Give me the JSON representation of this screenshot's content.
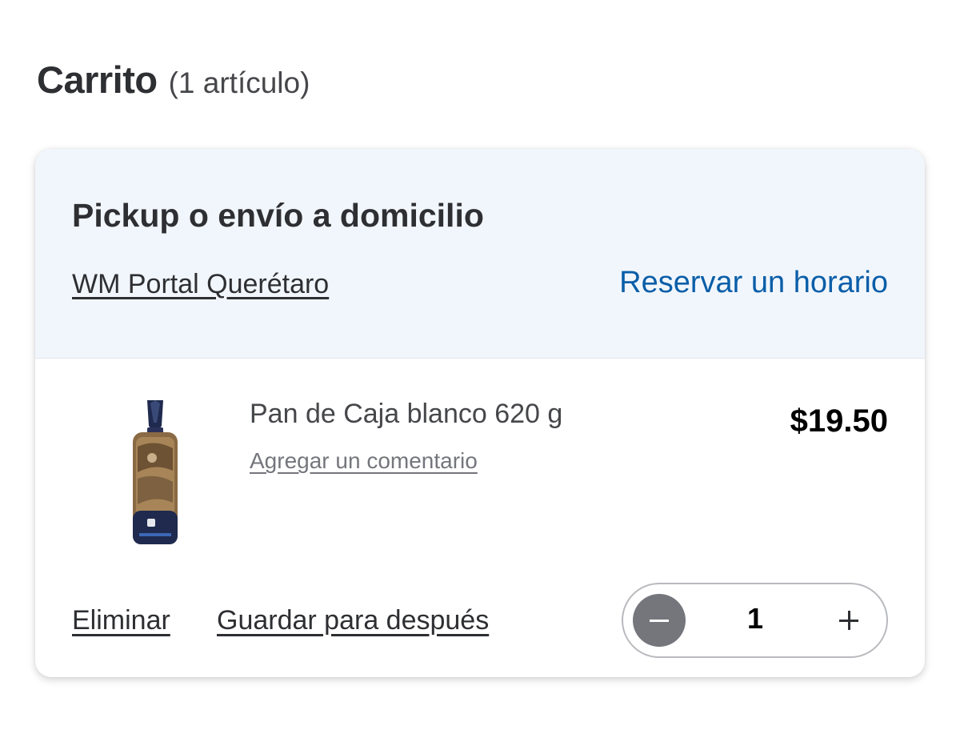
{
  "cart": {
    "title": "Carrito",
    "item_count": "(1 artículo)"
  },
  "fulfillment": {
    "title": "Pickup o envío a domicilio",
    "store": "WM Portal Querétaro",
    "reserve_label": "Reservar un horario"
  },
  "items": [
    {
      "name": "Pan de Caja blanco 620 g",
      "comment_label": "Agregar un comentario",
      "price": "$19.50",
      "quantity": "1",
      "remove_label": "Eliminar",
      "save_later_label": "Guardar para después",
      "image_icon": "bread-bag-image"
    }
  ],
  "colors": {
    "link_blue": "#0a5ea8",
    "header_bg": "#f1f6fc",
    "stepper_minus_bg": "#74767c"
  }
}
